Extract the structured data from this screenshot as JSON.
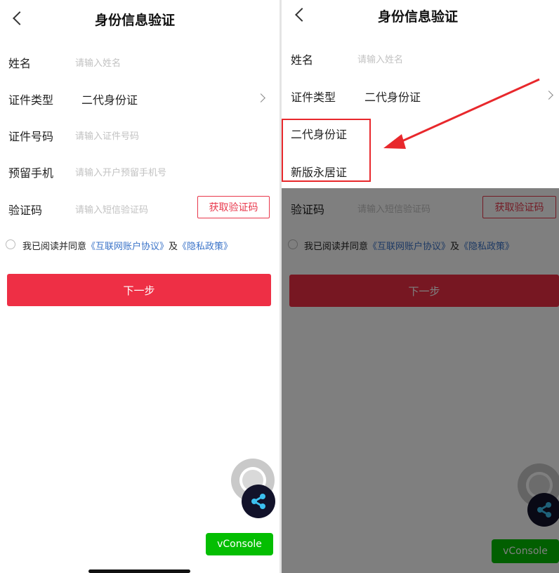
{
  "header": {
    "title": "身份信息验证"
  },
  "form": {
    "name_label": "姓名",
    "name_placeholder": "请输入姓名",
    "id_type_label": "证件类型",
    "id_type_value": "二代身份证",
    "id_number_label": "证件号码",
    "id_number_placeholder": "请输入证件号码",
    "phone_label": "预留手机",
    "phone_placeholder": "请输入开户预留手机号",
    "code_label": "验证码",
    "code_placeholder": "请输入短信验证码",
    "get_code_label": "获取验证码"
  },
  "agreement": {
    "prefix": "我已阅读并同意",
    "account_link": "《互联网账户协议》",
    "and": "及",
    "privacy_link": "《隐私政策》"
  },
  "next_label": "下一步",
  "id_type_options": [
    "二代身份证",
    "新版永居证"
  ],
  "vconsole_label": "vConsole",
  "icons": {
    "back": "chevron-left-icon",
    "chevron": "chevron-right-icon",
    "share": "share-icon",
    "floating": "floating-ball-icon"
  },
  "colors": {
    "accent": "#ee2f45",
    "link": "#3a73c8",
    "vconsole": "#04be02",
    "annotation": "#e8282c"
  }
}
